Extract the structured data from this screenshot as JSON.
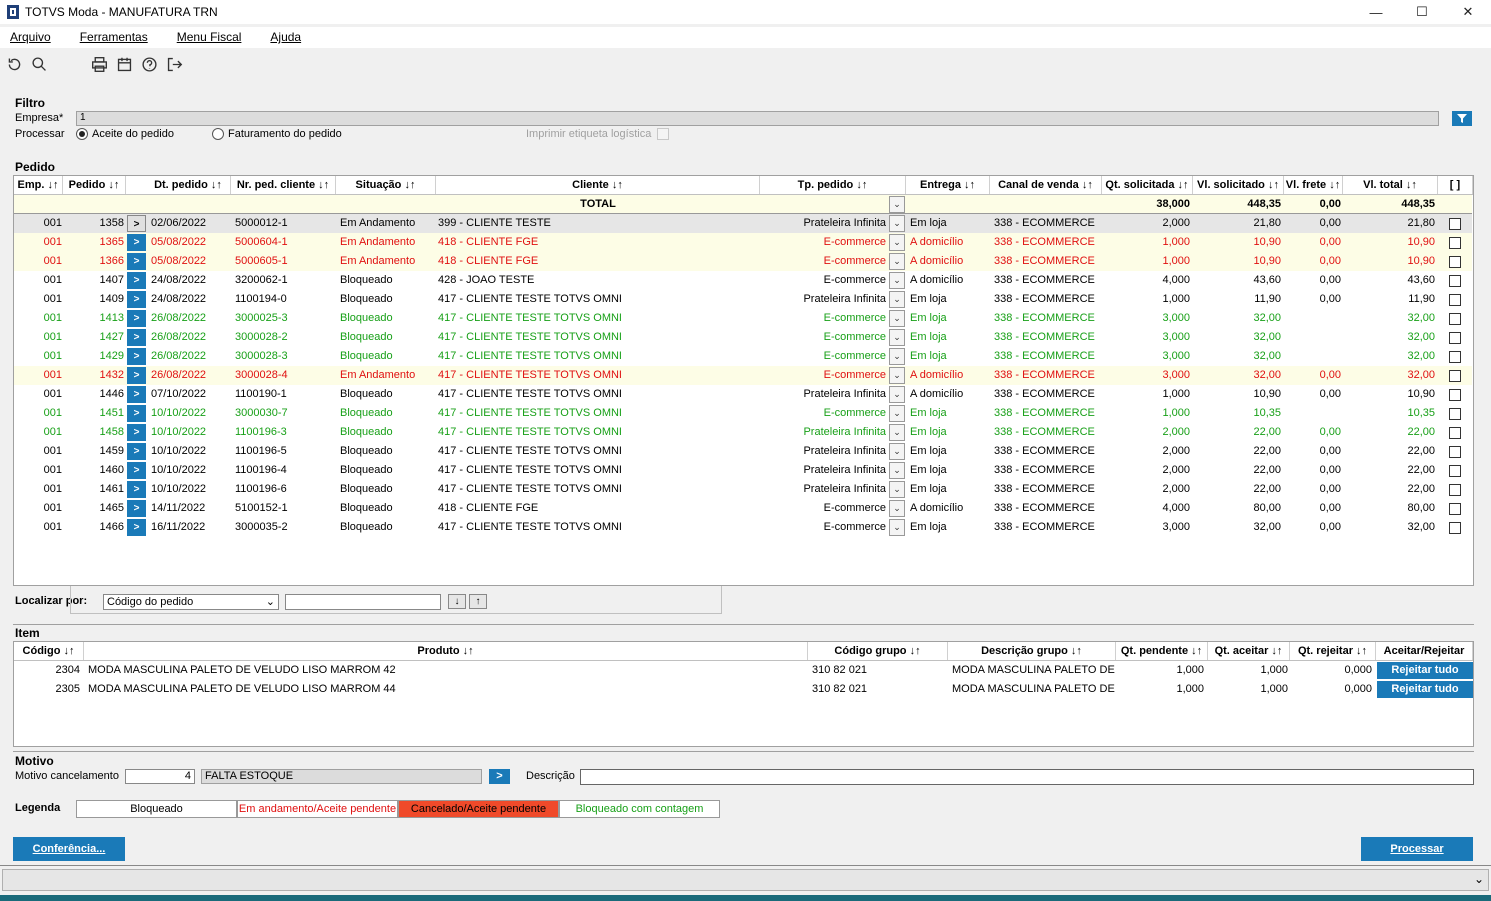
{
  "window": {
    "title": "TOTVS Moda - MANUFATURA TRN",
    "minimize": "—",
    "maximize": "☐",
    "close": "✕"
  },
  "menu": [
    "Arquivo",
    "Ferramentas",
    "Menu Fiscal",
    "Ajuda"
  ],
  "filtro": {
    "title": "Filtro",
    "empresa_label": "Empresa*",
    "empresa_value": "1",
    "processar_label": "Processar",
    "opt_aceite": "Aceite do pedido",
    "opt_faturamento": "Faturamento do pedido",
    "imprimir_label": "Imprimir etiqueta logística"
  },
  "pedido": {
    "title": "Pedido",
    "headers": [
      "Emp. ↓↑",
      "Pedido ↓↑",
      "Dt. pedido ↓↑",
      "Nr. ped. cliente ↓↑",
      "Situação ↓↑",
      "Cliente ↓↑",
      "Tp. pedido ↓↑",
      "Entrega ↓↑",
      "Canal de venda ↓↑",
      "Qt. solicitada ↓↑",
      "Vl. solicitado ↓↑",
      "Vl. frete ↓↑",
      "Vl. total ↓↑",
      "[ ]"
    ],
    "total": {
      "label": "TOTAL",
      "qt": "38,000",
      "vl_sol": "448,35",
      "frete": "0,00",
      "vl_total": "448,35"
    },
    "rows": [
      {
        "emp": "001",
        "ped": "1358",
        "dt": "02/06/2022",
        "nr": "5000012-1",
        "sit": "Em Andamento",
        "cli": "399 - CLIENTE TESTE",
        "tp": "Prateleira Infinita",
        "ent": "Em loja",
        "canal": "338 - ECOMMERCE",
        "qt": "2,000",
        "vs": "21,80",
        "vf": "0,00",
        "vt": "21,80",
        "color": "black",
        "bg": "sel"
      },
      {
        "emp": "001",
        "ped": "1365",
        "dt": "05/08/2022",
        "nr": "5000604-1",
        "sit": "Em Andamento",
        "cli": "418 - CLIENTE FGE",
        "tp": "E-commerce",
        "ent": "A domicílio",
        "canal": "338 - ECOMMERCE",
        "qt": "1,000",
        "vs": "10,90",
        "vf": "0,00",
        "vt": "10,90",
        "color": "red",
        "bg": "yel"
      },
      {
        "emp": "001",
        "ped": "1366",
        "dt": "05/08/2022",
        "nr": "5000605-1",
        "sit": "Em Andamento",
        "cli": "418 - CLIENTE FGE",
        "tp": "E-commerce",
        "ent": "A domicílio",
        "canal": "338 - ECOMMERCE",
        "qt": "1,000",
        "vs": "10,90",
        "vf": "0,00",
        "vt": "10,90",
        "color": "red",
        "bg": "yel"
      },
      {
        "emp": "001",
        "ped": "1407",
        "dt": "24/08/2022",
        "nr": "3200062-1",
        "sit": "Bloqueado",
        "cli": "428 - JOAO TESTE",
        "tp": "E-commerce",
        "ent": "A domicílio",
        "canal": "338 - ECOMMERCE",
        "qt": "4,000",
        "vs": "43,60",
        "vf": "0,00",
        "vt": "43,60",
        "color": "black",
        "bg": ""
      },
      {
        "emp": "001",
        "ped": "1409",
        "dt": "24/08/2022",
        "nr": "1100194-0",
        "sit": "Bloqueado",
        "cli": "417 - CLIENTE TESTE TOTVS OMNI",
        "tp": "Prateleira Infinita",
        "ent": "Em loja",
        "canal": "338 - ECOMMERCE",
        "qt": "1,000",
        "vs": "11,90",
        "vf": "0,00",
        "vt": "11,90",
        "color": "black",
        "bg": ""
      },
      {
        "emp": "001",
        "ped": "1413",
        "dt": "26/08/2022",
        "nr": "3000025-3",
        "sit": "Bloqueado",
        "cli": "417 - CLIENTE TESTE TOTVS OMNI",
        "tp": "E-commerce",
        "ent": "Em loja",
        "canal": "338 - ECOMMERCE",
        "qt": "3,000",
        "vs": "32,00",
        "vf": "",
        "vt": "32,00",
        "color": "green",
        "bg": ""
      },
      {
        "emp": "001",
        "ped": "1427",
        "dt": "26/08/2022",
        "nr": "3000028-2",
        "sit": "Bloqueado",
        "cli": "417 - CLIENTE TESTE TOTVS OMNI",
        "tp": "E-commerce",
        "ent": "Em loja",
        "canal": "338 - ECOMMERCE",
        "qt": "3,000",
        "vs": "32,00",
        "vf": "",
        "vt": "32,00",
        "color": "green",
        "bg": ""
      },
      {
        "emp": "001",
        "ped": "1429",
        "dt": "26/08/2022",
        "nr": "3000028-3",
        "sit": "Bloqueado",
        "cli": "417 - CLIENTE TESTE TOTVS OMNI",
        "tp": "E-commerce",
        "ent": "Em loja",
        "canal": "338 - ECOMMERCE",
        "qt": "3,000",
        "vs": "32,00",
        "vf": "",
        "vt": "32,00",
        "color": "green",
        "bg": ""
      },
      {
        "emp": "001",
        "ped": "1432",
        "dt": "26/08/2022",
        "nr": "3000028-4",
        "sit": "Em Andamento",
        "cli": "417 - CLIENTE TESTE TOTVS OMNI",
        "tp": "E-commerce",
        "ent": "A domicílio",
        "canal": "338 - ECOMMERCE",
        "qt": "3,000",
        "vs": "32,00",
        "vf": "0,00",
        "vt": "32,00",
        "color": "red",
        "bg": "yel"
      },
      {
        "emp": "001",
        "ped": "1446",
        "dt": "07/10/2022",
        "nr": "1100190-1",
        "sit": "Bloqueado",
        "cli": "417 - CLIENTE TESTE TOTVS OMNI",
        "tp": "Prateleira Infinita",
        "ent": "A domicílio",
        "canal": "338 - ECOMMERCE",
        "qt": "1,000",
        "vs": "10,90",
        "vf": "0,00",
        "vt": "10,90",
        "color": "black",
        "bg": ""
      },
      {
        "emp": "001",
        "ped": "1451",
        "dt": "10/10/2022",
        "nr": "3000030-7",
        "sit": "Bloqueado",
        "cli": "417 - CLIENTE TESTE TOTVS OMNI",
        "tp": "E-commerce",
        "ent": "Em loja",
        "canal": "338 - ECOMMERCE",
        "qt": "1,000",
        "vs": "10,35",
        "vf": "",
        "vt": "10,35",
        "color": "green",
        "bg": ""
      },
      {
        "emp": "001",
        "ped": "1458",
        "dt": "10/10/2022",
        "nr": "1100196-3",
        "sit": "Bloqueado",
        "cli": "417 - CLIENTE TESTE TOTVS OMNI",
        "tp": "Prateleira Infinita",
        "ent": "Em loja",
        "canal": "338 - ECOMMERCE",
        "qt": "2,000",
        "vs": "22,00",
        "vf": "0,00",
        "vt": "22,00",
        "color": "green",
        "bg": ""
      },
      {
        "emp": "001",
        "ped": "1459",
        "dt": "10/10/2022",
        "nr": "1100196-5",
        "sit": "Bloqueado",
        "cli": "417 - CLIENTE TESTE TOTVS OMNI",
        "tp": "Prateleira Infinita",
        "ent": "Em loja",
        "canal": "338 - ECOMMERCE",
        "qt": "2,000",
        "vs": "22,00",
        "vf": "0,00",
        "vt": "22,00",
        "color": "black",
        "bg": ""
      },
      {
        "emp": "001",
        "ped": "1460",
        "dt": "10/10/2022",
        "nr": "1100196-4",
        "sit": "Bloqueado",
        "cli": "417 - CLIENTE TESTE TOTVS OMNI",
        "tp": "Prateleira Infinita",
        "ent": "Em loja",
        "canal": "338 - ECOMMERCE",
        "qt": "2,000",
        "vs": "22,00",
        "vf": "0,00",
        "vt": "22,00",
        "color": "black",
        "bg": ""
      },
      {
        "emp": "001",
        "ped": "1461",
        "dt": "10/10/2022",
        "nr": "1100196-6",
        "sit": "Bloqueado",
        "cli": "417 - CLIENTE TESTE TOTVS OMNI",
        "tp": "Prateleira Infinita",
        "ent": "Em loja",
        "canal": "338 - ECOMMERCE",
        "qt": "2,000",
        "vs": "22,00",
        "vf": "0,00",
        "vt": "22,00",
        "color": "black",
        "bg": ""
      },
      {
        "emp": "001",
        "ped": "1465",
        "dt": "14/11/2022",
        "nr": "5100152-1",
        "sit": "Bloqueado",
        "cli": "418 - CLIENTE FGE",
        "tp": "E-commerce",
        "ent": "A domicílio",
        "canal": "338 - ECOMMERCE",
        "qt": "4,000",
        "vs": "80,00",
        "vf": "0,00",
        "vt": "80,00",
        "color": "black",
        "bg": ""
      },
      {
        "emp": "001",
        "ped": "1466",
        "dt": "16/11/2022",
        "nr": "3000035-2",
        "sit": "Bloqueado",
        "cli": "417 - CLIENTE TESTE TOTVS OMNI",
        "tp": "E-commerce",
        "ent": "Em loja",
        "canal": "338 - ECOMMERCE",
        "qt": "3,000",
        "vs": "32,00",
        "vf": "0,00",
        "vt": "32,00",
        "color": "black",
        "bg": ""
      }
    ]
  },
  "localizar": {
    "label": "Localizar por:",
    "select_value": "Código do pedido",
    "input_value": "",
    "down": "↓",
    "up": "↑"
  },
  "item": {
    "title": "Item",
    "headers": [
      "Código ↓↑",
      "Produto ↓↑",
      "Código grupo ↓↑",
      "Descrição grupo ↓↑",
      "Qt. pendente ↓↑",
      "Qt. aceitar ↓↑",
      "Qt. rejeitar ↓↑",
      "Aceitar/Rejeitar"
    ],
    "rows": [
      {
        "cod": "2304",
        "prod": "MODA MASCULINA PALETO DE VELUDO LISO MARROM 42",
        "grupo": "310 82 021",
        "desc": "MODA MASCULINA PALETO DE V",
        "pend": "1,000",
        "aceitar": "1,000",
        "rejeitar": "0,000",
        "btn": "Rejeitar tudo"
      },
      {
        "cod": "2305",
        "prod": "MODA MASCULINA PALETO DE VELUDO LISO MARROM 44",
        "grupo": "310 82 021",
        "desc": "MODA MASCULINA PALETO DE V",
        "pend": "1,000",
        "aceitar": "1,000",
        "rejeitar": "0,000",
        "btn": "Rejeitar tudo"
      }
    ]
  },
  "motivo": {
    "title": "Motivo",
    "label": "Motivo cancelamento",
    "code": "4",
    "desc_value": "FALTA ESTOQUE",
    "descricao_label": "Descrição",
    "descricao_value": ""
  },
  "legenda": {
    "title": "Legenda",
    "bloqueado": "Bloqueado",
    "andamento": "Em andamento/Aceite pendente",
    "cancelado": "Cancelado/Aceite pendente",
    "contagem": "Bloqueado com contagem"
  },
  "buttons": {
    "conferencia": "Conferência...",
    "processar": "Processar"
  },
  "colors": {
    "accent": "#1a7ab8",
    "red": "#e01010",
    "green": "#18a018",
    "cancel_bg": "#f04a2a"
  }
}
